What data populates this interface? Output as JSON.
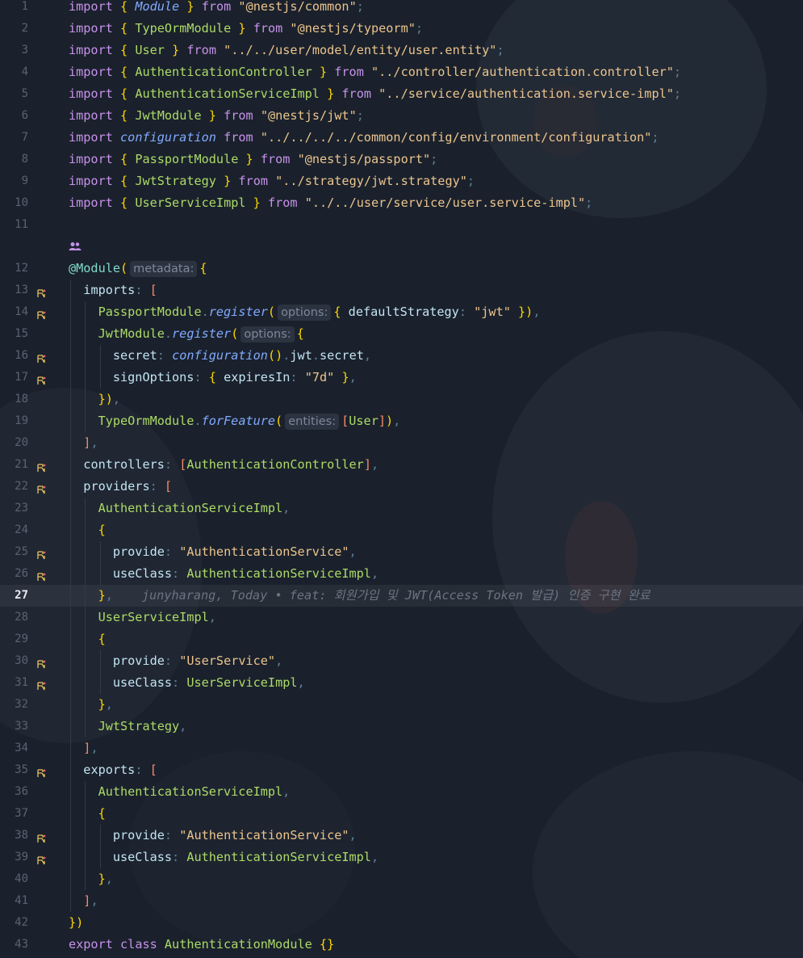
{
  "editor": {
    "blame_author": "junyharang",
    "inline_blame": "junyharang, Today • feat: 회원가입 및 JWT(Access Token 발급) 인증 구현 완료",
    "current_line": "27",
    "hints": {
      "metadata": "metadata:",
      "options": "options:",
      "entities": "entities:"
    },
    "lines": [
      {
        "n": "1",
        "t": "import { Module } from \"@nestjs/common\";"
      },
      {
        "n": "2",
        "t": "import { TypeOrmModule } from \"@nestjs/typeorm\";"
      },
      {
        "n": "3",
        "t": "import { User } from \"../../user/model/entity/user.entity\";"
      },
      {
        "n": "4",
        "t": "import { AuthenticationController } from \"../controller/authentication.controller\";"
      },
      {
        "n": "5",
        "t": "import { AuthenticationServiceImpl } from \"../service/authentication.service-impl\";"
      },
      {
        "n": "6",
        "t": "import { JwtModule } from \"@nestjs/jwt\";"
      },
      {
        "n": "7",
        "t": "import configuration from \"../../../../common/config/environment/configuration\";"
      },
      {
        "n": "8",
        "t": "import { PassportModule } from \"@nestjs/passport\";"
      },
      {
        "n": "9",
        "t": "import { JwtStrategy } from \"../strategy/jwt.strategy\";"
      },
      {
        "n": "10",
        "t": "import { UserServiceImpl } from \"../../user/service/user.service-impl\";"
      },
      {
        "n": "11",
        "t": ""
      },
      {
        "n": "12",
        "t": "@Module( metadata: {"
      },
      {
        "n": "13",
        "t": "  imports: ["
      },
      {
        "n": "14",
        "t": "    PassportModule.register( options: { defaultStrategy: \"jwt\" }),"
      },
      {
        "n": "15",
        "t": "    JwtModule.register( options: {"
      },
      {
        "n": "16",
        "t": "      secret: configuration().jwt.secret,"
      },
      {
        "n": "17",
        "t": "      signOptions: { expiresIn: \"7d\" },"
      },
      {
        "n": "18",
        "t": "    }),"
      },
      {
        "n": "19",
        "t": "    TypeOrmModule.forFeature( entities: [User]),"
      },
      {
        "n": "20",
        "t": "  ],"
      },
      {
        "n": "21",
        "t": "  controllers: [AuthenticationController],"
      },
      {
        "n": "22",
        "t": "  providers: ["
      },
      {
        "n": "23",
        "t": "    AuthenticationServiceImpl,"
      },
      {
        "n": "24",
        "t": "    {"
      },
      {
        "n": "25",
        "t": "      provide: \"AuthenticationService\","
      },
      {
        "n": "26",
        "t": "      useClass: AuthenticationServiceImpl,"
      },
      {
        "n": "27",
        "t": "    },"
      },
      {
        "n": "28",
        "t": "    UserServiceImpl,"
      },
      {
        "n": "29",
        "t": "    {"
      },
      {
        "n": "30",
        "t": "      provide: \"UserService\","
      },
      {
        "n": "31",
        "t": "      useClass: UserServiceImpl,"
      },
      {
        "n": "32",
        "t": "    },"
      },
      {
        "n": "33",
        "t": "    JwtStrategy,"
      },
      {
        "n": "34",
        "t": "  ],"
      },
      {
        "n": "35",
        "t": "  exports: ["
      },
      {
        "n": "36",
        "t": "    AuthenticationServiceImpl,"
      },
      {
        "n": "37",
        "t": "    {"
      },
      {
        "n": "38",
        "t": "      provide: \"AuthenticationService\","
      },
      {
        "n": "39",
        "t": "      useClass: AuthenticationServiceImpl,"
      },
      {
        "n": "40",
        "t": "    },"
      },
      {
        "n": "41",
        "t": "  ],"
      },
      {
        "n": "42",
        "t": "})"
      },
      {
        "n": "43",
        "t": "export class AuthenticationModule {}"
      }
    ],
    "gutter_icon_lines": [
      "13",
      "14",
      "16",
      "17",
      "21",
      "22",
      "25",
      "26",
      "30",
      "31",
      "35",
      "38",
      "39"
    ]
  },
  "colors": {
    "background": "#1a212c",
    "keyword": "#c792ea",
    "class": "#addb67",
    "string": "#ecc48d",
    "function": "#82aaff",
    "property": "#c3e4f3"
  }
}
